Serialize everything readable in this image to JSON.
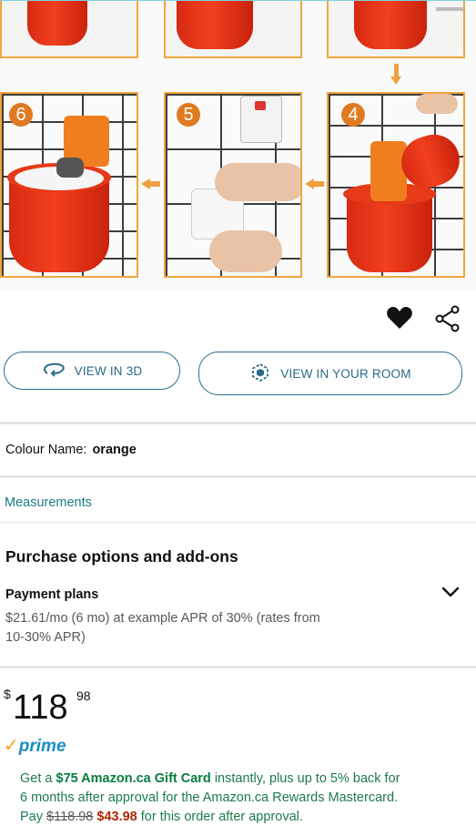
{
  "gallery": {
    "steps": [
      "6",
      "5",
      "4"
    ]
  },
  "actions": {
    "like_icon": "heart-icon",
    "share_icon": "share-icon"
  },
  "buttons": {
    "view3d": "VIEW IN 3D",
    "viewroom": "VIEW IN YOUR ROOM"
  },
  "colour": {
    "label": "Colour Name:",
    "value": "orange"
  },
  "measurements": "Measurements",
  "purchase": {
    "title": "Purchase options and add-ons",
    "payment_title": "Payment plans",
    "payment_line1": "$21.61/mo (6 mo) at example APR of 30% (rates from",
    "payment_line2": "10-30% APR)"
  },
  "price": {
    "symbol": "$",
    "whole": "118",
    "fraction": "98"
  },
  "prime": {
    "check": "✓",
    "label": "prime"
  },
  "promo": {
    "l1_pre": "Get a ",
    "l1_bold": "$75 Amazon.ca Gift Card",
    "l1_post": " instantly, plus up to 5% back for",
    "l2": "6 months after approval for the Amazon.ca Rewards Mastercard.",
    "l3_pre": "Pay ",
    "l3_strike": "$118.98",
    "l3_deal": " $43.98",
    "l3_post": " for this order after approval."
  },
  "colors": {
    "accent_teal": "#1c7a8a",
    "promo_green": "#067d3e",
    "deal_red": "#b12704",
    "prime_blue": "#1a8fbf",
    "step_orange": "#e07a22"
  }
}
